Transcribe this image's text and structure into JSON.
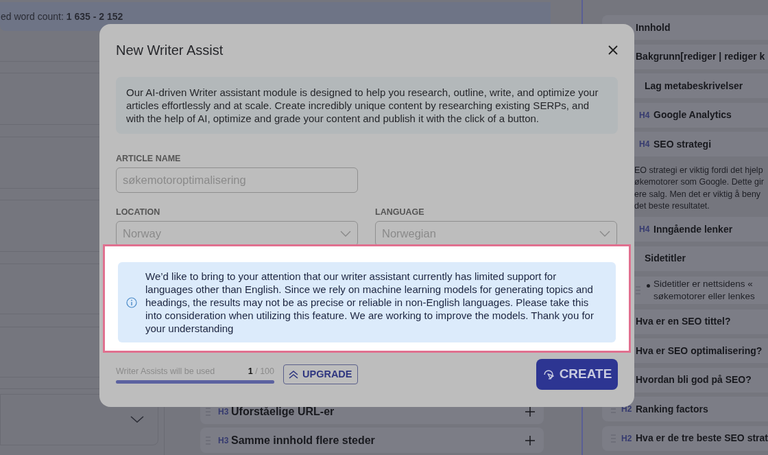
{
  "background": {
    "word_count": {
      "label": "ed word count:",
      "value": "1 635 - 2 152"
    },
    "outline": [
      {
        "level": "H3",
        "text": "Uforståelige URL-er"
      },
      {
        "level": "H3",
        "text": "Samme innhold flere steder"
      }
    ],
    "side_outline": [
      {
        "kind": "heading",
        "text": "Innhold"
      },
      {
        "kind": "heading",
        "text": "Bakgrunn[rediger | rediger k",
        "children": [
          {
            "kind": "heading",
            "text": "Lag metabeskrivelser",
            "children": [
              {
                "kind": "heading",
                "level": "H4",
                "text": "Google Analytics"
              },
              {
                "kind": "heading",
                "level": "H4",
                "text": "SEO strategi",
                "children": [
                  {
                    "kind": "paragraph",
                    "lines": [
                      "EO strategi er viktig fordi det hjelp",
                      "økemotorer som Google. Dette gir",
                      "ere salg. Men det er viktig å beny",
                      "det beste resultatet."
                    ]
                  }
                ]
              },
              {
                "kind": "heading",
                "level": "H4",
                "text": "Inngående lenker"
              }
            ]
          },
          {
            "kind": "heading",
            "text": "Sidetitler",
            "children": [
              {
                "kind": "bullet",
                "lines": [
                  "Sidetitler er nettsidens «",
                  "søkemotorer eller lenkes"
                ]
              }
            ]
          }
        ]
      },
      {
        "kind": "heading",
        "text": "Hva er en SEO tittel?"
      },
      {
        "kind": "heading",
        "text": "Hva er SEO optimalisering?"
      },
      {
        "kind": "heading",
        "text": "Hvordan bli god på SEO?"
      },
      {
        "kind": "heading",
        "level": "H2",
        "text": "Ranking factors"
      },
      {
        "kind": "heading",
        "level": "H2",
        "text": "Hva er de tre beste SEO strat"
      }
    ]
  },
  "modal": {
    "title": "New Writer Assist",
    "intro": "Our AI-driven Writer assistant module is designed to help you research, outline, write, and optimize your articles effortlessly and at scale. Create incredibly unique content by researching existing SERPs, and with the help of AI, optimize and grade your content and publish it with the click of a button.",
    "article_name": {
      "label": "ARTICLE NAME",
      "value": "søkemotoroptimalisering"
    },
    "location": {
      "label": "LOCATION",
      "value": "Norway"
    },
    "language": {
      "label": "LANGUAGE",
      "value": "Norwegian"
    },
    "notice": {
      "highlighted": true,
      "text": "We’d like to bring to your attention that our writer assistant currently has limited support for languages other than English. Since we rely on machine learning models for generating topics and headings, the results may not be as precise or reliable in non-English languages. Please take this into consideration when utilizing this feature. We are working to improve the models. Thank you for your understanding"
    },
    "usage": {
      "label": "Writer Assists will be used",
      "used": "1",
      "limit": "/ 100",
      "level": 1
    },
    "upgrade_button": "UPGRADE",
    "create_button": "CREATE"
  }
}
